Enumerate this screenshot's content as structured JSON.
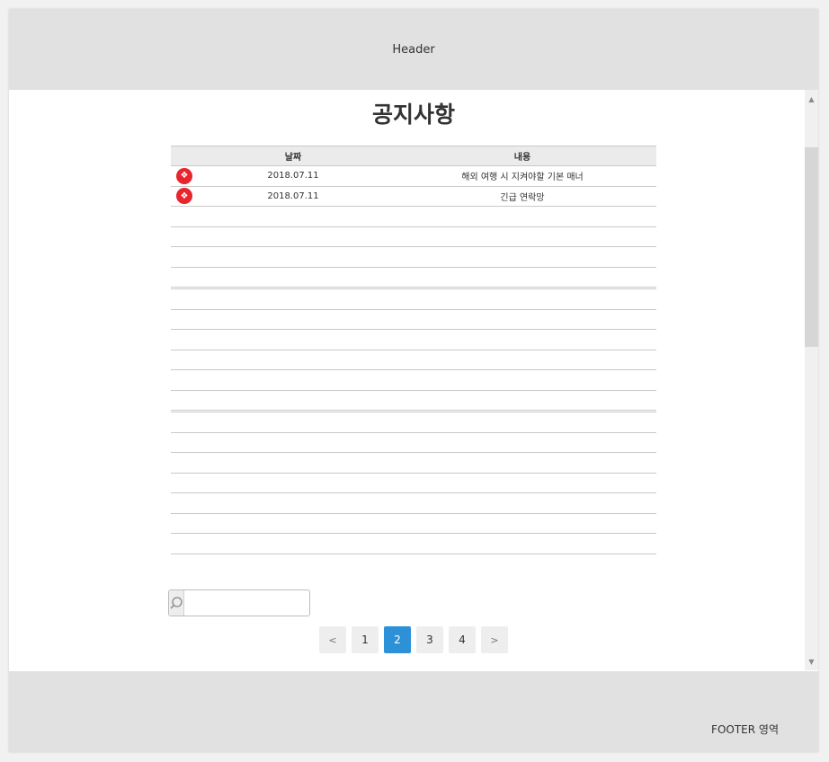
{
  "header": {
    "title": "Header"
  },
  "page": {
    "title": "공지사항"
  },
  "table": {
    "columns": [
      "날짜",
      "내용"
    ],
    "rows": [
      {
        "date": "2018.07.11",
        "content": "해외 여행 시 지켜야할 기본 매너"
      },
      {
        "date": "2018.07.11",
        "content": "긴급 연락망"
      }
    ]
  },
  "search": {
    "value": "",
    "placeholder": ""
  },
  "pagination": {
    "prev": "<",
    "pages": [
      "1",
      "2",
      "3",
      "4"
    ],
    "current": "2",
    "next": ">"
  },
  "footer": {
    "text": "FOOTER 영역"
  },
  "colors": {
    "accent": "#2d91d8",
    "badge": "#e8242c",
    "header_bg": "#e1e1e1"
  },
  "icons": {
    "row_badge": "notice-badge-icon",
    "search": "search-icon"
  }
}
